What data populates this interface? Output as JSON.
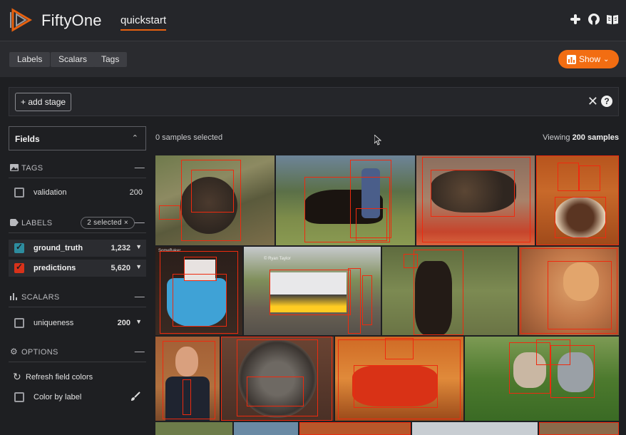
{
  "header": {
    "app_name": "FiftyOne",
    "dataset_name": "quickstart",
    "icons": [
      "slack-icon",
      "github-icon",
      "docs-book-icon"
    ]
  },
  "toolbar": {
    "tabs": [
      "Labels",
      "Scalars",
      "Tags"
    ],
    "show_label": "Show"
  },
  "stage_bar": {
    "add_stage_label": "+ add stage"
  },
  "sidebar": {
    "fields_label": "Fields",
    "tags": {
      "title": "TAGS",
      "items": [
        {
          "label": "validation",
          "count": "200"
        }
      ]
    },
    "labels": {
      "title": "LABELS",
      "selected_pill": "2 selected ×",
      "items": [
        {
          "label": "ground_truth",
          "count": "1,232",
          "color": "#2d8c9e"
        },
        {
          "label": "predictions",
          "count": "5,620",
          "color": "#d8321a"
        }
      ]
    },
    "scalars": {
      "title": "SCALARS",
      "items": [
        {
          "label": "uniqueness",
          "count": "200"
        }
      ]
    },
    "options": {
      "title": "OPTIONS",
      "refresh_label": "Refresh field colors",
      "color_by_label": "Color by label"
    }
  },
  "status": {
    "selected_text": "0 samples selected",
    "viewing_prefix": "Viewing ",
    "viewing_count": "200 samples"
  },
  "colors": {
    "accent": "#f26d12",
    "box_red": "#ee2a0f",
    "ground_truth": "#2d8c9e",
    "predictions": "#d8321a"
  },
  "grid": {
    "tiles": [
      {
        "subject": "turkey",
        "photo_text": ""
      },
      {
        "subject": "cowboy-on-horse",
        "photo_text": ""
      },
      {
        "subject": "cat-on-couch",
        "photo_text": ""
      },
      {
        "subject": "dinner-table",
        "photo_text": ""
      },
      {
        "subject": "birthday-cake",
        "photo_text": "SomeBaker"
      },
      {
        "subject": "passenger-train",
        "photo_text": "© Ryan Taylor"
      },
      {
        "subject": "cow",
        "photo_text": ""
      },
      {
        "subject": "orange-cat",
        "photo_text": ""
      },
      {
        "subject": "man-in-suit",
        "photo_text": ""
      },
      {
        "subject": "cat-in-bowl",
        "photo_text": ""
      },
      {
        "subject": "pizza-plate",
        "photo_text": ""
      },
      {
        "subject": "dogs-on-grass",
        "photo_text": ""
      }
    ]
  }
}
